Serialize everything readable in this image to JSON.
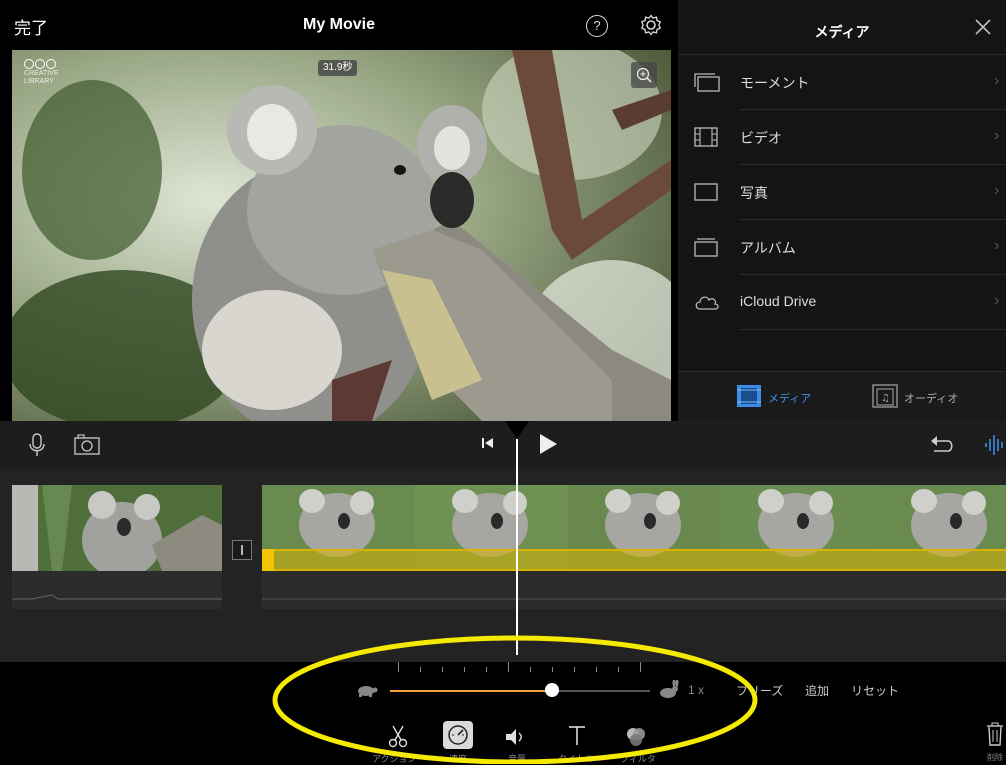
{
  "top_bar": {
    "done_label": "完了",
    "title": "My Movie",
    "help_label": "?"
  },
  "viewer": {
    "duration_badge": "31.9秒",
    "logo_text": "CREATIVE LIBRARY"
  },
  "media_panel": {
    "title": "メディア",
    "items": [
      {
        "label": "モーメント",
        "icon": "moments-icon"
      },
      {
        "label": "ビデオ",
        "icon": "film-icon"
      },
      {
        "label": "写真",
        "icon": "photo-icon"
      },
      {
        "label": "アルバム",
        "icon": "album-icon"
      },
      {
        "label": "iCloud Drive",
        "icon": "cloud-icon"
      }
    ],
    "tabs": {
      "media_label": "メディア",
      "audio_label": "オーディオ"
    },
    "active_tab_color": "#3c8dea"
  },
  "speed_controls": {
    "speed_value": "1 x",
    "freeze_label": "フリーズ",
    "add_label": "追加",
    "reset_label": "リセット",
    "slider_accent": "#f0a43a"
  },
  "tools": [
    {
      "label": "アクション",
      "icon": "scissors-icon"
    },
    {
      "label": "速度",
      "icon": "speedometer-icon"
    },
    {
      "label": "音量",
      "icon": "volume-icon"
    },
    {
      "label": "タイトル",
      "icon": "title-icon"
    },
    {
      "label": "フィルタ",
      "icon": "filters-icon"
    }
  ],
  "trash": {
    "label": "削除"
  },
  "highlight_color": "#f5ea00"
}
